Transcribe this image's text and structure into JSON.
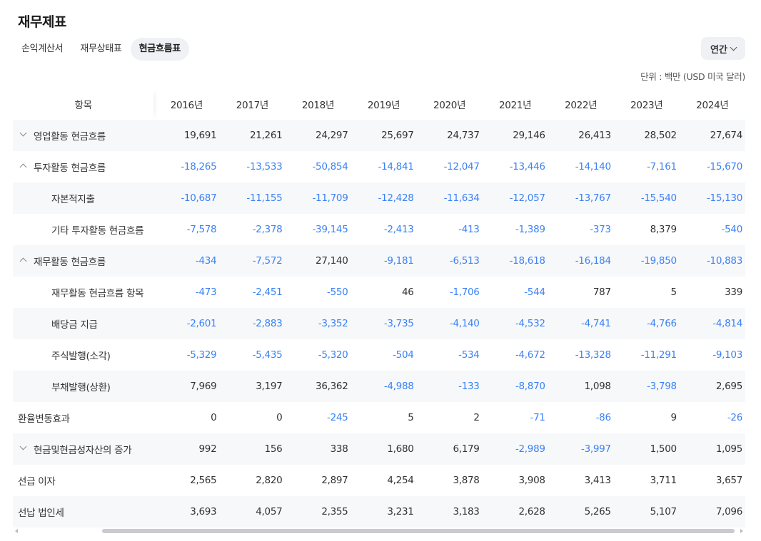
{
  "page": {
    "title": "재무제표"
  },
  "tabs": [
    {
      "label": "손익계산서",
      "active": false
    },
    {
      "label": "재무상태표",
      "active": false
    },
    {
      "label": "현금흐름표",
      "active": true
    }
  ],
  "period": {
    "label": "연간"
  },
  "unit": "단위 : 백만 (USD 미국 달러)",
  "table": {
    "item_header": "항목",
    "years": [
      "2016년",
      "2017년",
      "2018년",
      "2019년",
      "2020년",
      "2021년",
      "2022년",
      "2023년",
      "2024년"
    ],
    "rows": [
      {
        "label": "영업활동 현금흐름",
        "level": 1,
        "toggle": "down",
        "values": [
          "19,691",
          "21,261",
          "24,297",
          "25,697",
          "24,737",
          "29,146",
          "26,413",
          "28,502",
          "27,674"
        ]
      },
      {
        "label": "투자활동 현금흐름",
        "level": 1,
        "toggle": "up",
        "values": [
          "-18,265",
          "-13,533",
          "-50,854",
          "-14,841",
          "-12,047",
          "-13,446",
          "-14,140",
          "-7,161",
          "-15,670"
        ]
      },
      {
        "label": "자본적지출",
        "level": 2,
        "toggle": "",
        "values": [
          "-10,687",
          "-11,155",
          "-11,709",
          "-12,428",
          "-11,634",
          "-12,057",
          "-13,767",
          "-15,540",
          "-15,130"
        ]
      },
      {
        "label": "기타 투자활동 현금흐름",
        "level": 2,
        "toggle": "",
        "values": [
          "-7,578",
          "-2,378",
          "-39,145",
          "-2,413",
          "-413",
          "-1,389",
          "-373",
          "8,379",
          "-540"
        ]
      },
      {
        "label": "재무활동 현금흐름",
        "level": 1,
        "toggle": "up",
        "values": [
          "-434",
          "-7,572",
          "27,140",
          "-9,181",
          "-6,513",
          "-18,618",
          "-16,184",
          "-19,850",
          "-10,883"
        ]
      },
      {
        "label": "재무활동 현금흐름 항목",
        "level": 2,
        "toggle": "",
        "values": [
          "-473",
          "-2,451",
          "-550",
          "46",
          "-1,706",
          "-544",
          "787",
          "5",
          "339"
        ]
      },
      {
        "label": "배당금 지급",
        "level": 2,
        "toggle": "",
        "values": [
          "-2,601",
          "-2,883",
          "-3,352",
          "-3,735",
          "-4,140",
          "-4,532",
          "-4,741",
          "-4,766",
          "-4,814"
        ]
      },
      {
        "label": "주식발행(소각)",
        "level": 2,
        "toggle": "",
        "values": [
          "-5,329",
          "-5,435",
          "-5,320",
          "-504",
          "-534",
          "-4,672",
          "-13,328",
          "-11,291",
          "-9,103"
        ]
      },
      {
        "label": "부채발행(상환)",
        "level": 2,
        "toggle": "",
        "values": [
          "7,969",
          "3,197",
          "36,362",
          "-4,988",
          "-133",
          "-8,870",
          "1,098",
          "-3,798",
          "2,695"
        ]
      },
      {
        "label": "환율변동효과",
        "level": 0,
        "toggle": "",
        "values": [
          "0",
          "0",
          "-245",
          "5",
          "2",
          "-71",
          "-86",
          "9",
          "-26"
        ]
      },
      {
        "label": "현금및현금성자산의 증가",
        "level": 1,
        "toggle": "down",
        "values": [
          "992",
          "156",
          "338",
          "1,680",
          "6,179",
          "-2,989",
          "-3,997",
          "1,500",
          "1,095"
        ]
      },
      {
        "label": "선급 이자",
        "level": 0,
        "toggle": "",
        "values": [
          "2,565",
          "2,820",
          "2,897",
          "4,254",
          "3,878",
          "3,908",
          "3,413",
          "3,711",
          "3,657"
        ]
      },
      {
        "label": "선납 법인세",
        "level": 0,
        "toggle": "",
        "values": [
          "3,693",
          "4,057",
          "2,355",
          "3,231",
          "3,183",
          "2,628",
          "5,265",
          "5,107",
          "7,096"
        ]
      }
    ]
  },
  "colors": {
    "negative": "#3b82f6",
    "row_shade": "#f7f8fa",
    "pill_bg": "#f0f1f4"
  }
}
